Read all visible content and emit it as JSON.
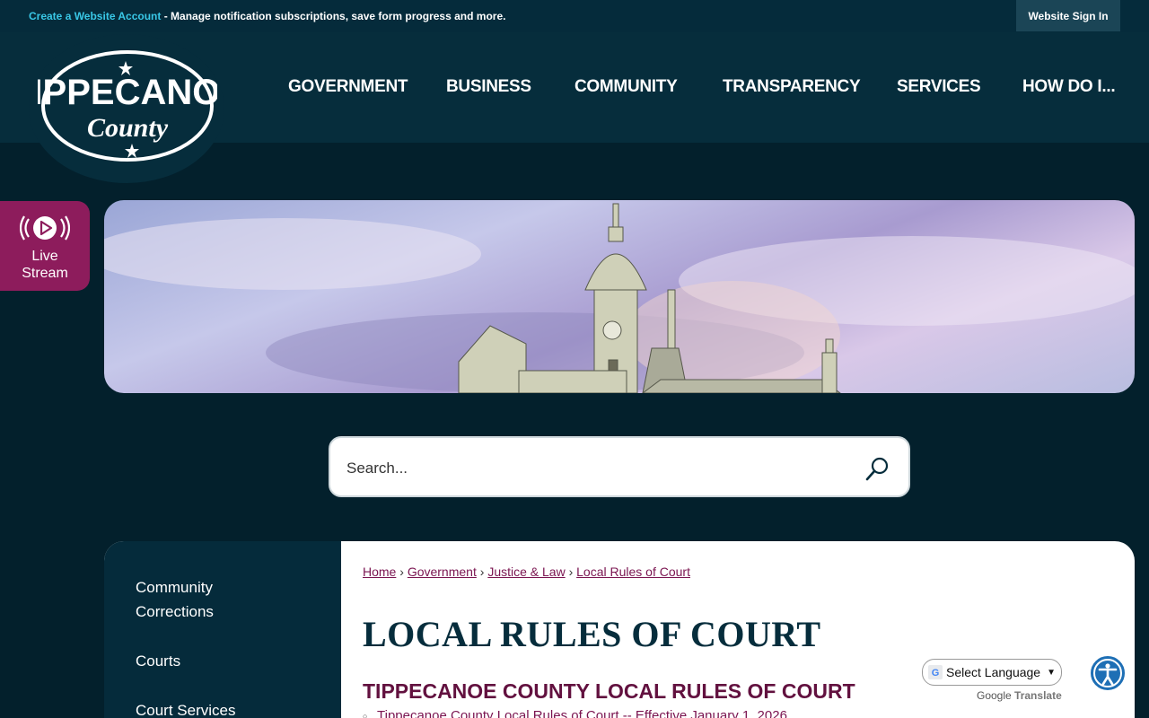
{
  "topbar": {
    "create_account_link": "Create a Website Account",
    "create_account_suffix": " - Manage notification subscriptions, save form progress and more.",
    "sign_in": "Website Sign In"
  },
  "logo": {
    "line1": "TIPPECANOE",
    "line2": "County"
  },
  "nav": {
    "items": [
      {
        "label": "GOVERNMENT"
      },
      {
        "label": "BUSINESS"
      },
      {
        "label": "COMMUNITY"
      },
      {
        "label": "TRANSPARENCY"
      },
      {
        "label": "SERVICES"
      },
      {
        "label": "HOW DO I..."
      }
    ]
  },
  "live_stream": {
    "line1": "Live",
    "line2": "Stream"
  },
  "search": {
    "placeholder": "Search..."
  },
  "sidebar": {
    "items": [
      {
        "line1": "Community",
        "line2": "Corrections"
      },
      {
        "label": "Courts"
      },
      {
        "label": "Court Services"
      }
    ]
  },
  "breadcrumb": {
    "items": [
      "Home",
      "Government",
      "Justice & Law",
      "Local Rules of Court"
    ],
    "separator": "›"
  },
  "page": {
    "title": "LOCAL RULES OF COURT",
    "section_title": "TIPPECANOE COUNTY LOCAL RULES OF COURT",
    "doc_link": "Tippecanoe County Local Rules of Court -- Effective January 1, 2026"
  },
  "translate": {
    "select_label": "Select Language",
    "powered_by": "Google",
    "translate_word": "Translate"
  },
  "colors": {
    "bg_dark": "#03202c",
    "header": "#062d3c",
    "accent_link": "#39c7e6",
    "live_stream": "#8d1c5c",
    "heading": "#062d3c",
    "section_heading": "#62113f",
    "link": "#7a1450",
    "accessibility": "#1e6fb5"
  },
  "icons": {
    "live": "broadcast-play-icon",
    "search": "magnifier-icon",
    "accessibility": "accessibility-person-icon",
    "google": "google-g-icon"
  }
}
